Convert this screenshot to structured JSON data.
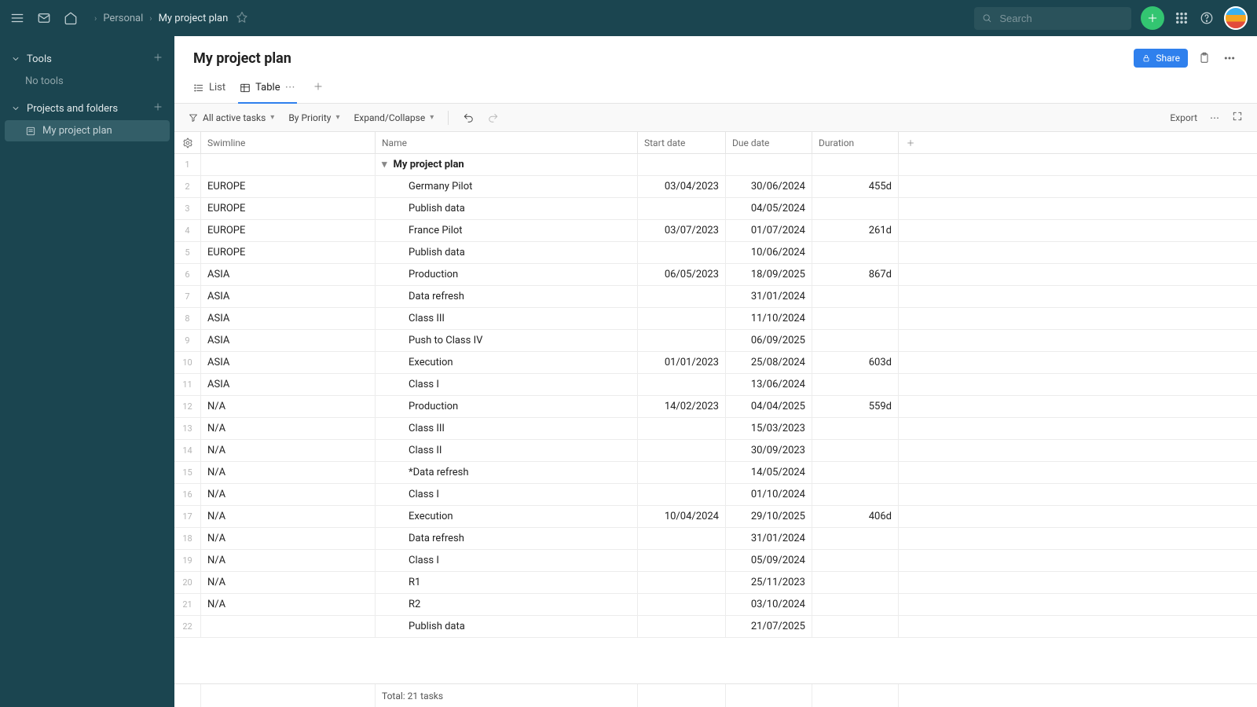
{
  "header": {
    "breadcrumb_root": "Personal",
    "breadcrumb_current": "My project plan",
    "search_placeholder": "Search"
  },
  "sidebar": {
    "groups": [
      {
        "label": "Tools",
        "empty": "No tools"
      },
      {
        "label": "Projects and folders"
      }
    ],
    "project_item": "My project plan"
  },
  "page": {
    "title": "My project plan",
    "share": "Share",
    "tabs": {
      "list": "List",
      "table": "Table"
    },
    "toolbar": {
      "filter": "All active tasks",
      "sort": "By Priority",
      "expand": "Expand/Collapse",
      "export": "Export"
    }
  },
  "table": {
    "columns": {
      "swimline": "Swimline",
      "name": "Name",
      "start": "Start date",
      "due": "Due date",
      "duration": "Duration"
    },
    "group_name": "My project plan",
    "footer": "Total: 21 tasks",
    "rows": [
      {
        "n": 2,
        "swim": "EUROPE",
        "name": "Germany Pilot",
        "start": "03/04/2023",
        "due": "30/06/2024",
        "dur": "455d"
      },
      {
        "n": 3,
        "swim": "EUROPE",
        "name": "Publish data",
        "start": "",
        "due": "04/05/2024",
        "dur": ""
      },
      {
        "n": 4,
        "swim": "EUROPE",
        "name": "France Pilot",
        "start": "03/07/2023",
        "due": "01/07/2024",
        "dur": "261d"
      },
      {
        "n": 5,
        "swim": "EUROPE",
        "name": "Publish data",
        "start": "",
        "due": "10/06/2024",
        "dur": ""
      },
      {
        "n": 6,
        "swim": "ASIA",
        "name": "Production",
        "start": "06/05/2023",
        "due": "18/09/2025",
        "dur": "867d"
      },
      {
        "n": 7,
        "swim": "ASIA",
        "name": "Data refresh",
        "start": "",
        "due": "31/01/2024",
        "dur": ""
      },
      {
        "n": 8,
        "swim": "ASIA",
        "name": "Class III",
        "start": "",
        "due": "11/10/2024",
        "dur": ""
      },
      {
        "n": 9,
        "swim": "ASIA",
        "name": "Push to Class IV",
        "start": "",
        "due": "06/09/2025",
        "dur": ""
      },
      {
        "n": 10,
        "swim": "ASIA",
        "name": "Execution",
        "start": "01/01/2023",
        "due": "25/08/2024",
        "dur": "603d"
      },
      {
        "n": 11,
        "swim": "ASIA",
        "name": "Class I",
        "start": "",
        "due": "13/06/2024",
        "dur": ""
      },
      {
        "n": 12,
        "swim": "N/A",
        "name": "Production",
        "start": "14/02/2023",
        "due": "04/04/2025",
        "dur": "559d"
      },
      {
        "n": 13,
        "swim": "N/A",
        "name": "Class III",
        "start": "",
        "due": "15/03/2023",
        "dur": ""
      },
      {
        "n": 14,
        "swim": "N/A",
        "name": "Class II",
        "start": "",
        "due": "30/09/2023",
        "dur": ""
      },
      {
        "n": 15,
        "swim": "N/A",
        "name": "*Data refresh",
        "start": "",
        "due": "14/05/2024",
        "dur": ""
      },
      {
        "n": 16,
        "swim": "N/A",
        "name": "Class I",
        "start": "",
        "due": "01/10/2024",
        "dur": ""
      },
      {
        "n": 17,
        "swim": "N/A",
        "name": "Execution",
        "start": "10/04/2024",
        "due": "29/10/2025",
        "dur": "406d"
      },
      {
        "n": 18,
        "swim": "N/A",
        "name": "Data refresh",
        "start": "",
        "due": "31/01/2024",
        "dur": ""
      },
      {
        "n": 19,
        "swim": "N/A",
        "name": "Class I",
        "start": "",
        "due": "05/09/2024",
        "dur": ""
      },
      {
        "n": 20,
        "swim": "N/A",
        "name": "R1",
        "start": "",
        "due": "25/11/2023",
        "dur": ""
      },
      {
        "n": 21,
        "swim": "N/A",
        "name": "R2",
        "start": "",
        "due": "03/10/2024",
        "dur": ""
      },
      {
        "n": 22,
        "swim": "",
        "name": "Publish data",
        "start": "",
        "due": "21/07/2025",
        "dur": ""
      }
    ]
  }
}
